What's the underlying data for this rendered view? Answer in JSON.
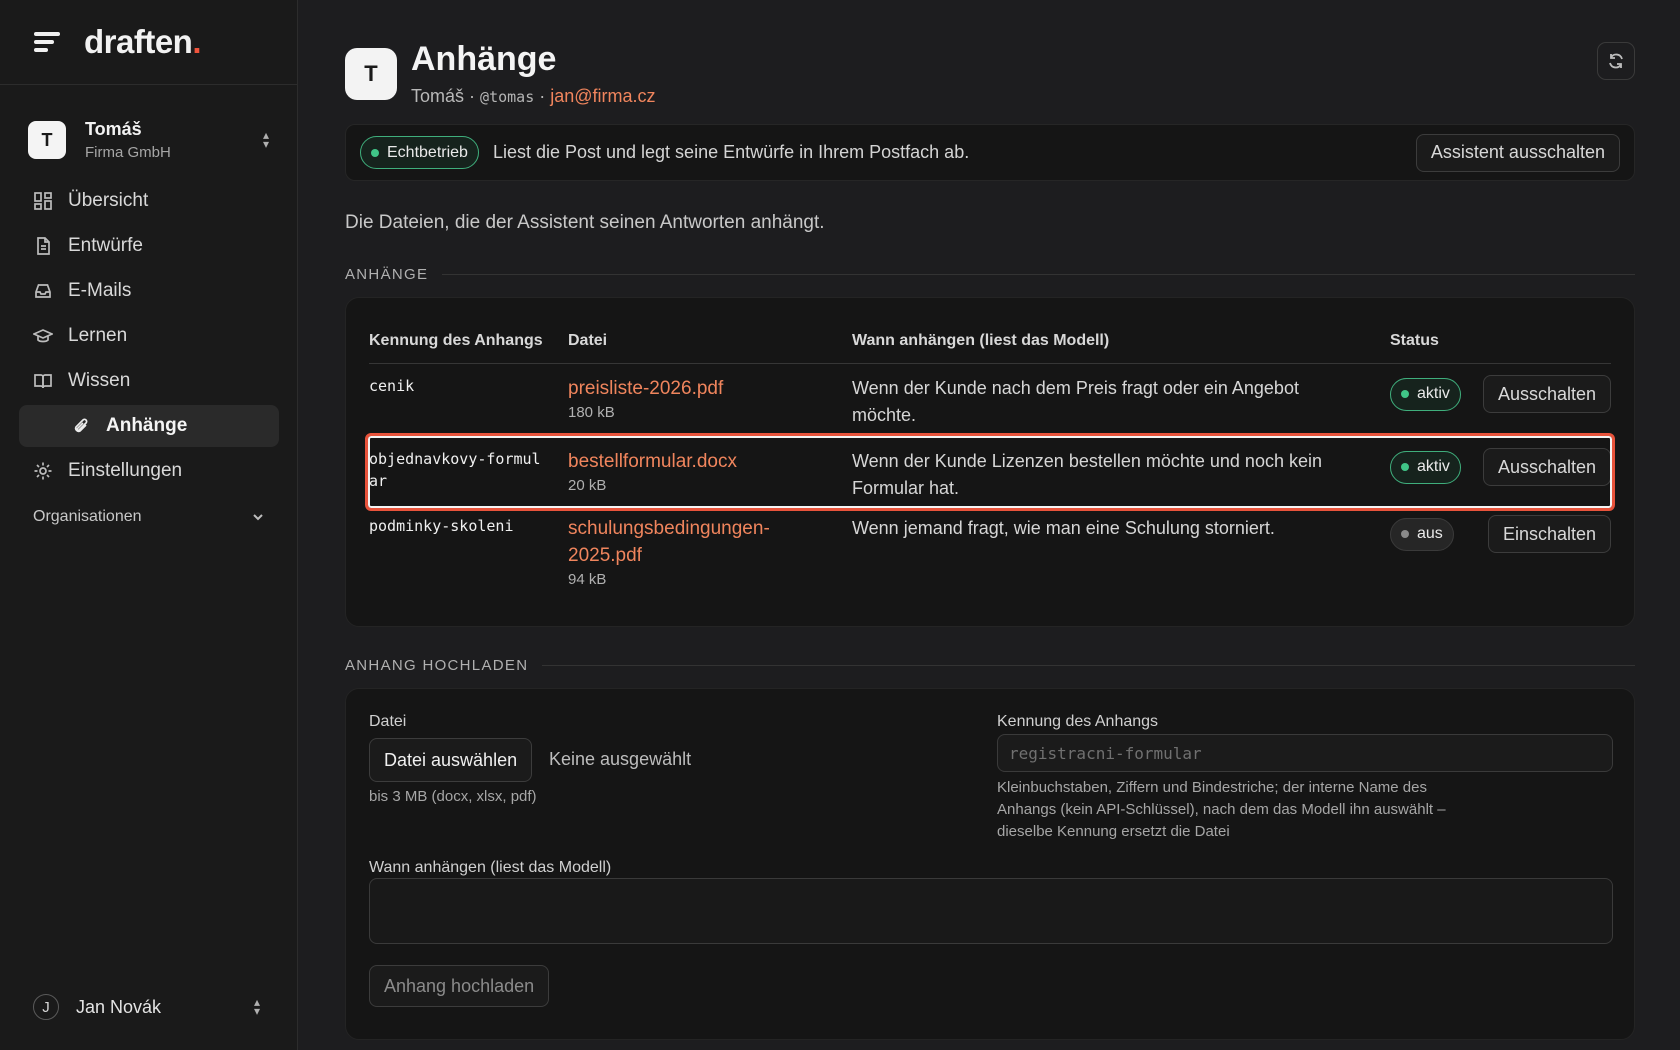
{
  "sidebar": {
    "brand": "draften",
    "brand_dot": ".",
    "org": {
      "initial": "T",
      "name": "Tomáš",
      "company": "Firma GmbH"
    },
    "nav": [
      {
        "label": "Übersicht",
        "icon": "grid-icon"
      },
      {
        "label": "Entwürfe",
        "icon": "document-icon"
      },
      {
        "label": "E-Mails",
        "icon": "inbox-icon"
      },
      {
        "label": "Lernen",
        "icon": "graduation-cap-icon"
      },
      {
        "label": "Wissen",
        "icon": "book-icon"
      },
      {
        "label": "Anhänge",
        "icon": "paperclip-icon",
        "active": true
      },
      {
        "label": "Einstellungen",
        "icon": "gear-icon"
      }
    ],
    "group": "Organisationen",
    "user": {
      "initial": "J",
      "name": "Jan Novák"
    }
  },
  "header": {
    "initial": "T",
    "title": "Anhänge",
    "name": "Tomáš",
    "sep": "·",
    "handle": "@tomas",
    "email": "jan@firma.cz"
  },
  "status": {
    "badge": "Echtbetrieb",
    "text": "Liest die Post und legt seine Entwürfe in Ihrem Postfach ab.",
    "button": "Assistent ausschalten"
  },
  "lead": "Die Dateien, die der Assistent seinen Antworten anhängt.",
  "attachments": {
    "section_title": "ANHÄNGE",
    "columns": [
      "Kennung des Anhangs",
      "Datei",
      "Wann anhängen (liest das Modell)",
      "Status"
    ],
    "rows": [
      {
        "id": "cenik",
        "file": "preisliste-2026.pdf",
        "size": "180 kB",
        "when": "Wenn der Kunde nach dem Preis fragt oder ein Angebot möchte.",
        "status": "aktiv",
        "action": "Ausschalten"
      },
      {
        "id": "objednavkovy-formular",
        "file": "bestellformular.docx",
        "size": "20 kB",
        "when": "Wenn der Kunde Lizenzen bestellen möchte und noch kein Formular hat.",
        "status": "aktiv",
        "action": "Ausschalten"
      },
      {
        "id": "podminky-skoleni",
        "file": "schulungsbedingungen-2025.pdf",
        "size": "94 kB",
        "when": "Wenn jemand fragt, wie man eine Schulung storniert.",
        "status": "aus",
        "action": "Einschalten"
      }
    ]
  },
  "upload": {
    "section_title": "ANHANG HOCHLADEN",
    "file_label": "Datei",
    "choose_button": "Datei auswählen",
    "none_chosen": "Keine ausgewählt",
    "file_help": "bis 3 MB (docx, xlsx, pdf)",
    "id_label": "Kennung des Anhangs",
    "id_placeholder": "registracni-formular",
    "id_help": "Kleinbuchstaben, Ziffern und Bindestriche; der interne Name des Anhangs (kein API-Schlüssel), nach dem das Modell ihn auswählt – dieselbe Kennung ersetzt die Datei",
    "when_label": "Wann anhängen (liest das Modell)",
    "submit": "Anhang hochladen"
  },
  "colors": {
    "accent": "#f0543c",
    "link": "#f0855d",
    "active_green": "#40c587"
  }
}
